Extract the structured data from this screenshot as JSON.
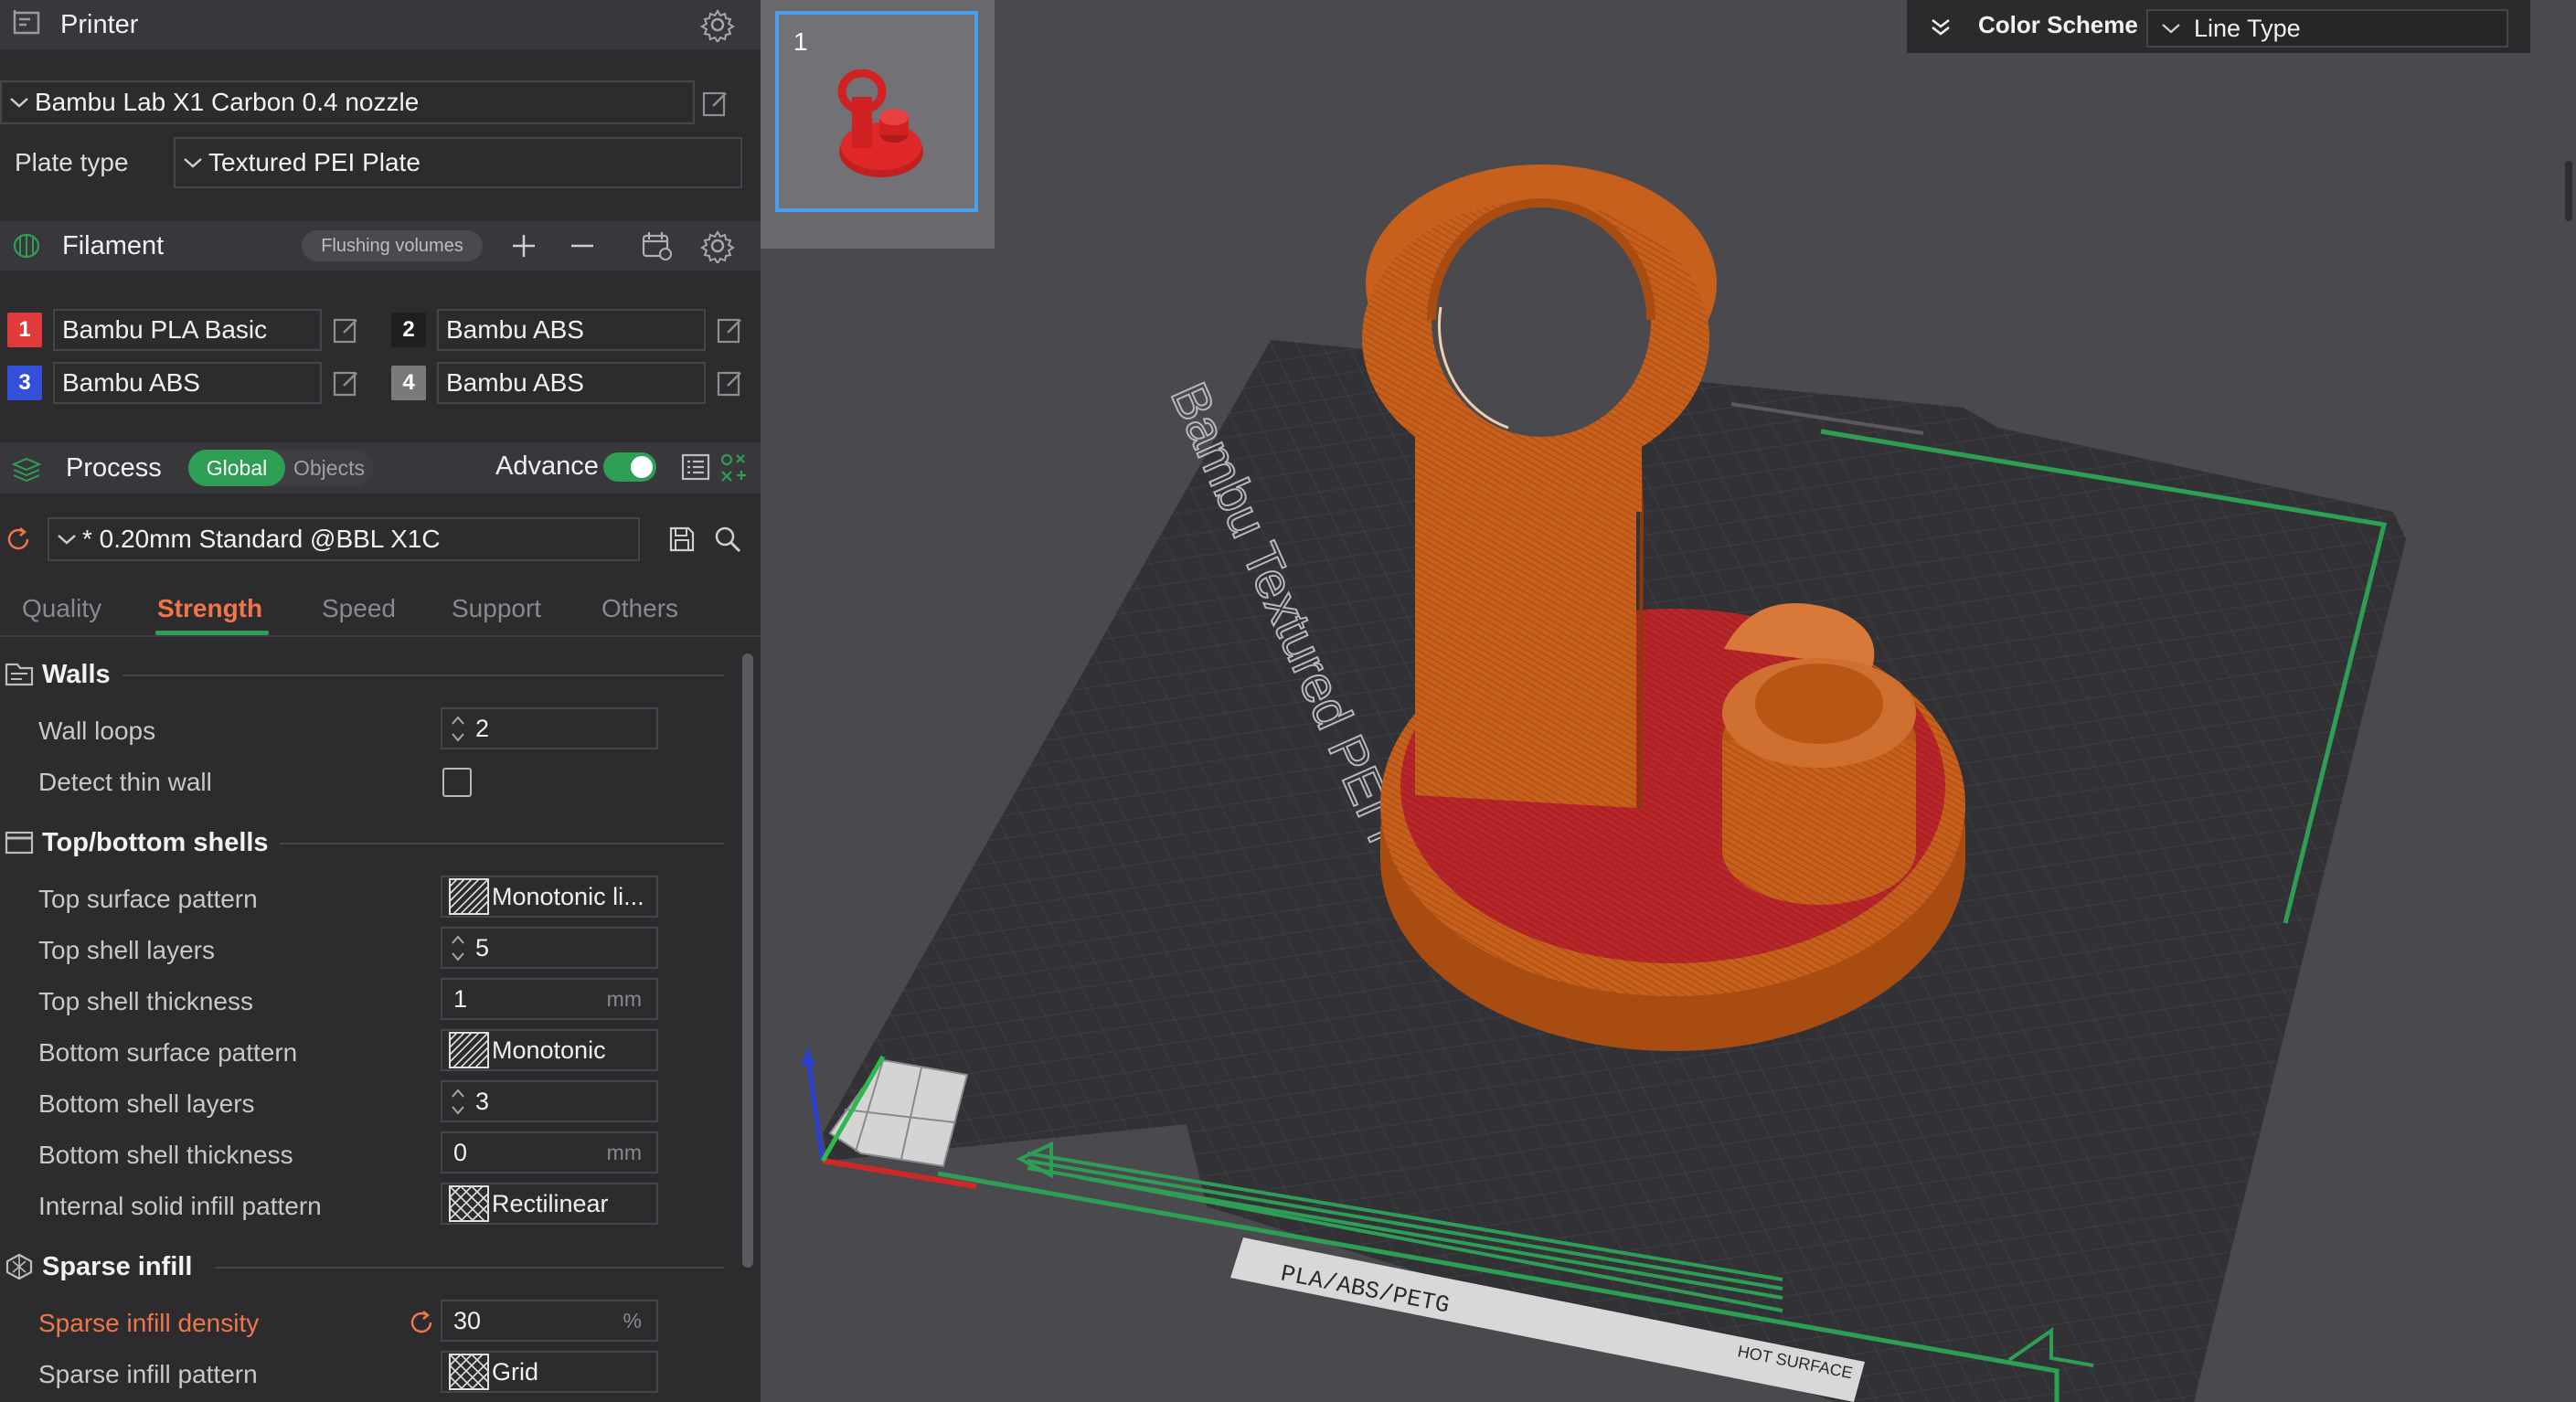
{
  "printer": {
    "title": "Printer",
    "printer_name": "Bambu Lab X1 Carbon 0.4 nozzle",
    "plate_type_label": "Plate type",
    "plate_type_value": "Textured PEI Plate"
  },
  "filament": {
    "title": "Filament",
    "flushing_label": "Flushing volumes",
    "items": [
      {
        "num": "1",
        "name": "Bambu PLA Basic",
        "color": "#e03a3a"
      },
      {
        "num": "2",
        "name": "Bambu ABS",
        "color": "#1f1f1f"
      },
      {
        "num": "3",
        "name": "Bambu ABS",
        "color": "#3450d8"
      },
      {
        "num": "4",
        "name": "Bambu ABS",
        "color": "#7a7a7a"
      }
    ]
  },
  "process": {
    "title": "Process",
    "global_label": "Global",
    "objects_label": "Objects",
    "advance_label": "Advance",
    "advance_on": true,
    "preset": "* 0.20mm Standard @BBL X1C"
  },
  "tabs": {
    "quality": "Quality",
    "strength": "Strength",
    "speed": "Speed",
    "support": "Support",
    "others": "Others",
    "active": "Strength"
  },
  "walls": {
    "title": "Walls",
    "wall_loops_label": "Wall loops",
    "wall_loops_value": "2",
    "detect_thin_wall_label": "Detect thin wall",
    "detect_thin_wall_checked": false
  },
  "shells": {
    "title": "Top/bottom shells",
    "top_surface_pattern_label": "Top surface pattern",
    "top_surface_pattern_value": "Monotonic li...",
    "top_shell_layers_label": "Top shell layers",
    "top_shell_layers_value": "5",
    "top_shell_thickness_label": "Top shell thickness",
    "top_shell_thickness_value": "1",
    "bottom_surface_pattern_label": "Bottom surface pattern",
    "bottom_surface_pattern_value": "Monotonic",
    "bottom_shell_layers_label": "Bottom shell layers",
    "bottom_shell_layers_value": "3",
    "bottom_shell_thickness_label": "Bottom shell thickness",
    "bottom_shell_thickness_value": "0",
    "internal_solid_infill_label": "Internal solid infill pattern",
    "internal_solid_infill_value": "Rectilinear",
    "unit_mm": "mm"
  },
  "sparse": {
    "title": "Sparse infill",
    "density_label": "Sparse infill density",
    "density_value": "30",
    "density_unit": "%",
    "pattern_label": "Sparse infill pattern",
    "pattern_value": "Grid"
  },
  "viewport": {
    "plate_number": "1",
    "color_scheme_label": "Color Scheme",
    "color_scheme_value": "Line Type",
    "bed_text": "Bambu Textured PEI Plate",
    "bed_strip_text": "PLA/ABS/PETG",
    "hot_surface_text": "HOT SURFACE",
    "colors": {
      "model_orange": "#c7601c",
      "model_red": "#b8262a",
      "bed": "#323236",
      "bed_line": "#2f9e55",
      "accent": "#f0764a"
    }
  }
}
